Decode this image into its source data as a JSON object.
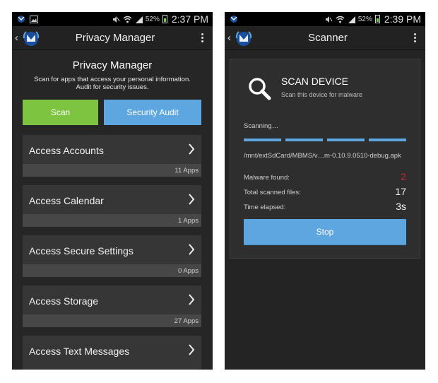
{
  "left_screen": {
    "status_bar": {
      "battery_percent": "52%",
      "time": "2:37 PM"
    },
    "action_bar": {
      "back_glyph": "‹",
      "title": "Privacy Manager"
    },
    "heading": "Privacy Manager",
    "description_line1": "Scan for apps that access your personal information.",
    "description_line2": "Audit for security issues.",
    "buttons": {
      "scan": "Scan",
      "security_audit": "Security Audit"
    },
    "access_items": [
      {
        "label": "Access Accounts",
        "count": "11 Apps"
      },
      {
        "label": "Access Calendar",
        "count": "1 Apps"
      },
      {
        "label": "Access Secure Settings",
        "count": "0 Apps"
      },
      {
        "label": "Access Storage",
        "count": "27 Apps"
      },
      {
        "label": "Access Text Messages",
        "count": ""
      }
    ],
    "colors": {
      "scan_button": "#7dc540",
      "audit_button": "#5ea6df"
    }
  },
  "right_screen": {
    "status_bar": {
      "battery_percent": "52%",
      "time": "2:39 PM"
    },
    "action_bar": {
      "back_glyph": "‹",
      "title": "Scanner"
    },
    "panel": {
      "title": "SCAN DEVICE",
      "subtitle": "Scan this device for malware",
      "scanning_label": "Scanning…",
      "current_path": "/mnt/extSdCard/MBMS/v…m-0.10.9.0510-debug.apk",
      "stats": [
        {
          "label": "Malware found:",
          "value": "2"
        },
        {
          "label": "Total scanned files:",
          "value": "17"
        },
        {
          "label": "Time elapsed:",
          "value": "3s"
        }
      ],
      "stop_button": "Stop"
    },
    "colors": {
      "progress": "#5ea6df",
      "malware_count": "#c32a2a",
      "stop_button": "#5ea6df"
    }
  },
  "icons": [
    "app-logo-icon",
    "chevron-right-icon",
    "magnifier-icon",
    "wifi-icon",
    "signal-icon",
    "battery-icon",
    "mute-icon",
    "overflow-menu-icon"
  ]
}
